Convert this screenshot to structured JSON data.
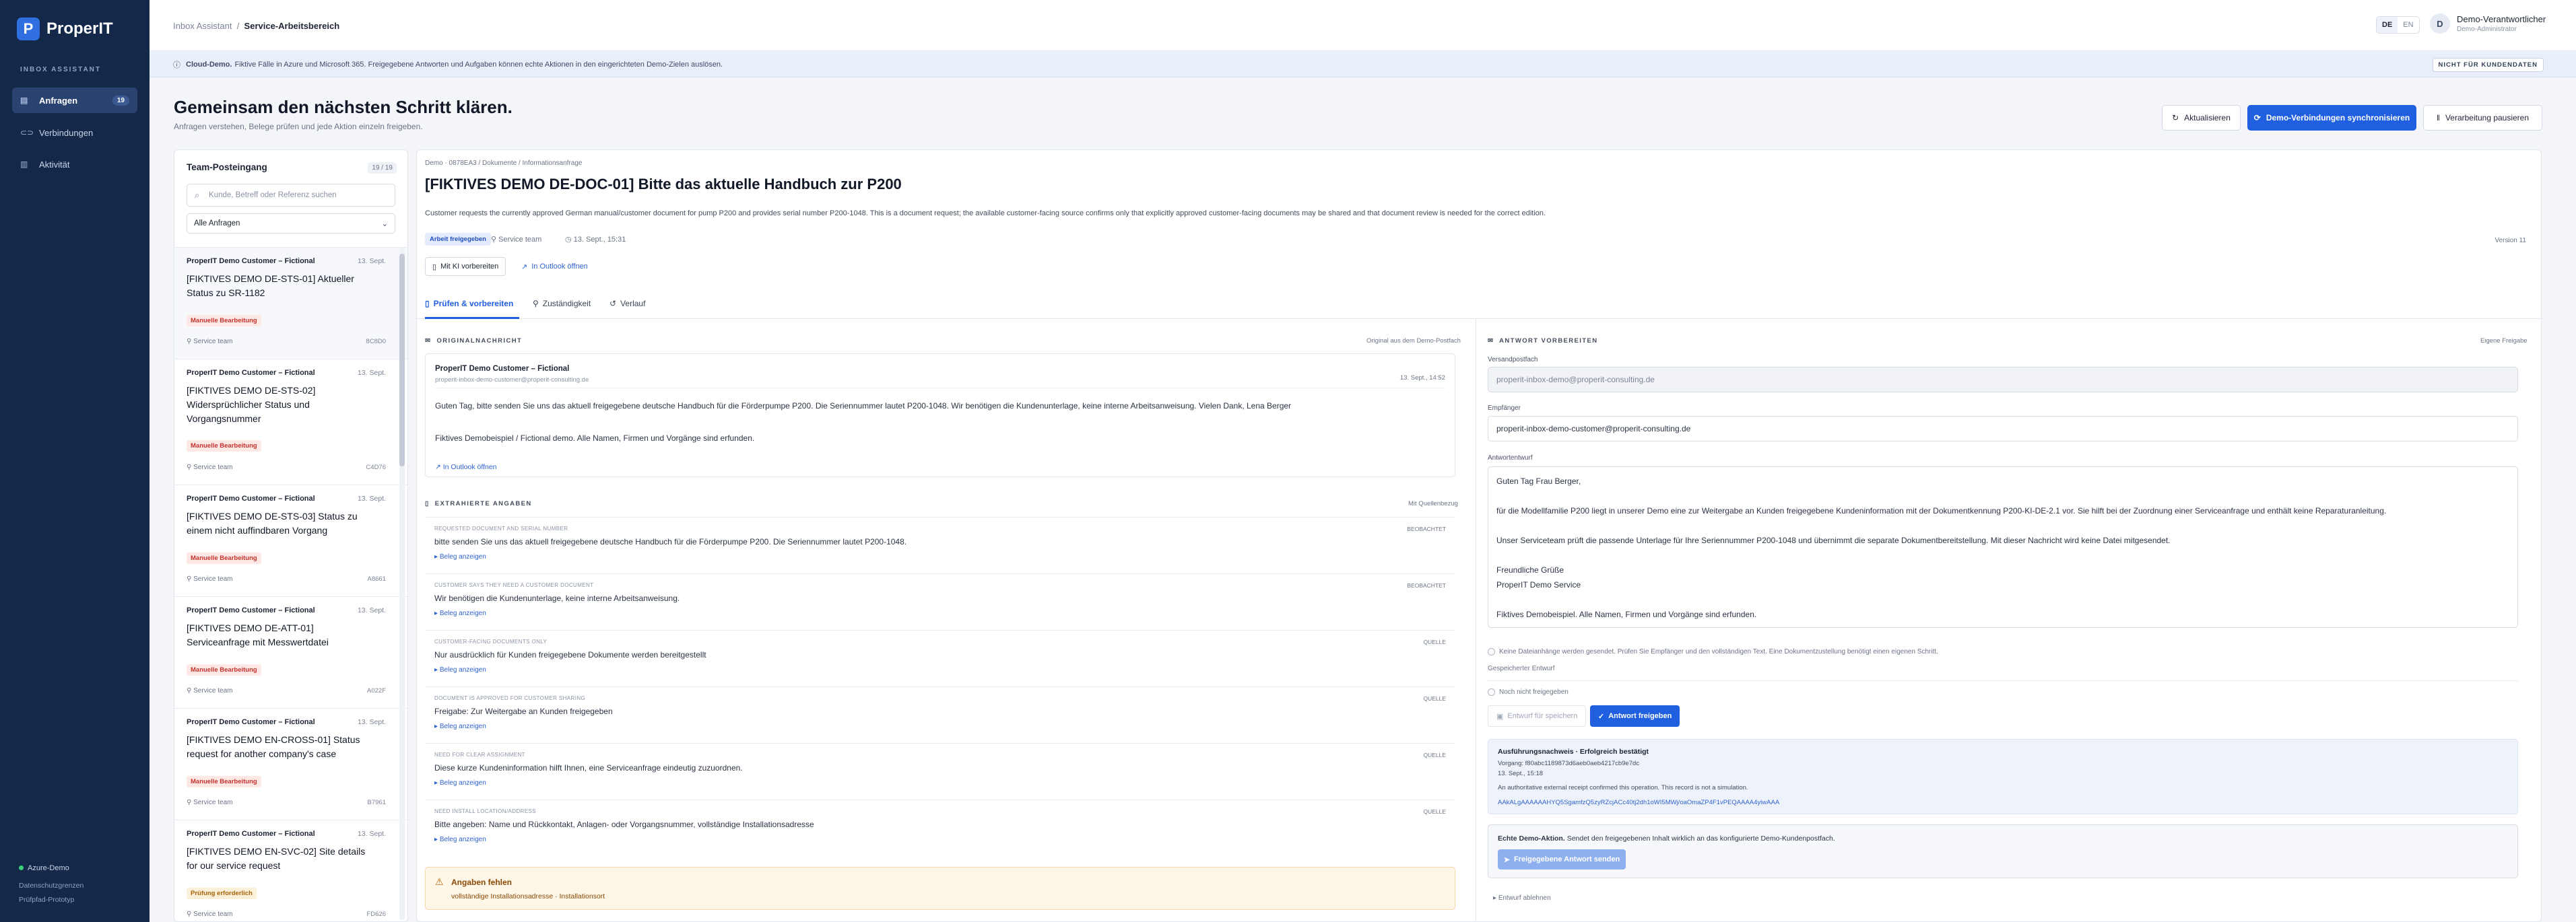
{
  "app": {
    "logo_letter": "P",
    "name": "ProperIT",
    "section": "INBOX ASSISTANT"
  },
  "sidebar": {
    "items": [
      {
        "label": "Anfragen",
        "badge": "19",
        "icon": "inbox-icon"
      },
      {
        "label": "Verbindungen",
        "icon": "link-icon"
      },
      {
        "label": "Aktivität",
        "icon": "activity-icon"
      }
    ],
    "env": "Azure-Demo",
    "footer1": "Datenschutzgrenzen",
    "footer2": "Prüfpfad-Prototyp"
  },
  "topbar": {
    "crumb1": "Inbox Assistant",
    "sep": "/",
    "crumb2": "Service-Arbeitsbereich",
    "lang": [
      "DE",
      "EN"
    ],
    "lang_active": "DE",
    "avatar": "D",
    "user": "Demo-Verantwortlicher",
    "role": "Demo-Administrator"
  },
  "banner": {
    "strong": "Cloud-Demo.",
    "text": "Fiktive Fälle in Azure und Microsoft 365. Freigegebene Antworten und Aufgaben können echte Aktionen in den eingerichteten Demo-Zielen auslösen.",
    "tag": "NICHT FÜR KUNDENDATEN"
  },
  "page": {
    "title": "Gemeinsam den nächsten Schritt klären.",
    "subtitle": "Anfragen verstehen, Belege prüfen und jede Aktion einzeln freigeben.",
    "btn_refresh": "Aktualisieren",
    "btn_sync": "Demo-Verbindungen synchronisieren",
    "btn_pause": "Verarbeitung pausieren"
  },
  "inbox": {
    "title": "Team-Posteingang",
    "count": "19 / 19",
    "search_placeholder": "Kunde, Betreff oder Referenz suchen",
    "filter": "Alle Anfragen",
    "items": [
      {
        "customer": "ProperIT Demo Customer – Fictional",
        "date": "13. Sept.",
        "title": "[FIKTIVES DEMO DE-STS-01] Aktueller Status zu SR-1182",
        "tag": "Manuelle Bearbeitung",
        "team": "Service team",
        "ref": "8C8D0"
      },
      {
        "customer": "ProperIT Demo Customer – Fictional",
        "date": "13. Sept.",
        "title": "[FIKTIVES DEMO DE-STS-02] Widersprüchlicher Status und Vorgangsnummer",
        "tag": "Manuelle Bearbeitung",
        "team": "Service team",
        "ref": "C4D76"
      },
      {
        "customer": "ProperIT Demo Customer – Fictional",
        "date": "13. Sept.",
        "title": "[FIKTIVES DEMO DE-STS-03] Status zu einem nicht auffindbaren Vorgang",
        "tag": "Manuelle Bearbeitung",
        "team": "Service team",
        "ref": "A8661"
      },
      {
        "customer": "ProperIT Demo Customer – Fictional",
        "date": "13. Sept.",
        "title": "[FIKTIVES DEMO DE-ATT-01] Serviceanfrage mit Messwertdatei",
        "tag": "Manuelle Bearbeitung",
        "team": "Service team",
        "ref": "A022F"
      },
      {
        "customer": "ProperIT Demo Customer – Fictional",
        "date": "13. Sept.",
        "title": "[FIKTIVES DEMO EN-CROSS-01] Status request for another company's case",
        "tag": "Manuelle Bearbeitung",
        "team": "Service team",
        "ref": "B7961"
      },
      {
        "customer": "ProperIT Demo Customer – Fictional",
        "date": "13. Sept.",
        "title": "[FIKTIVES DEMO EN-SVC-02] Site details for our service request",
        "tag": "Prüfung erforderlich",
        "team": "Service team",
        "ref": "FD626"
      }
    ]
  },
  "detail": {
    "crumb": "Demo · 0878EA3   /   Dokumente / Informationsanfrage",
    "title": "[FIKTIVES DEMO DE-DOC-01] Bitte das aktuelle Handbuch zur P200",
    "description": "Customer requests the currently approved German manual/customer document for pump P200 and provides serial number P200-1048. This is a document request; the available customer-facing source confirms only that explicitly approved customer-facing documents may be shared and that document review is needed for the correct edition.",
    "status_pill": "Arbeit freigegeben",
    "team": "Service team",
    "time": "13. Sept., 15:31",
    "version": "Version 11",
    "btn_ai": "Mit KI vorbereiten",
    "btn_outlook": "In Outlook öffnen",
    "tabs": [
      "Prüfen & vorbereiten",
      "Zuständigkeit",
      "Verlauf"
    ],
    "original": {
      "section": "ORIGINALNACHRICHT",
      "section_right": "Original aus dem Demo-Postfach",
      "from": "ProperIT Demo Customer – Fictional",
      "email": "properit-inbox-demo-customer@properit-consulting.de",
      "date": "13. Sept., 14:52",
      "body": "Guten Tag, bitte senden Sie uns das aktuell freigegebene deutsche Handbuch für die Förderpumpe P200. Die Seriennummer lautet P200-1048. Wir benötigen die Kundenunterlage, keine interne Arbeitsanweisung. Vielen Dank, Lena Berger",
      "disclaimer": "Fiktives Demobeispiel / Fictional demo. Alle Namen, Firmen und Vorgänge sind erfunden.",
      "link": "In Outlook öffnen"
    },
    "extracted": {
      "section": "EXTRAHIERTE ANGABEN",
      "section_right": "Mit Quellenbezug",
      "fields": [
        {
          "label": "REQUESTED DOCUMENT AND SERIAL NUMBER",
          "conf": "BEOBACHTET",
          "value": "bitte senden Sie uns das aktuell freigegebene deutsche Handbuch für die Förderpumpe P200. Die Seriennummer lautet P200-1048.",
          "src": "Beleg anzeigen"
        },
        {
          "label": "CUSTOMER SAYS THEY NEED A CUSTOMER DOCUMENT",
          "conf": "BEOBACHTET",
          "value": "Wir benötigen die Kundenunterlage, keine interne Arbeitsanweisung.",
          "src": "Beleg anzeigen"
        },
        {
          "label": "CUSTOMER-FACING DOCUMENTS ONLY",
          "conf": "QUELLE",
          "value": "Nur ausdrücklich für Kunden freigegebene Dokumente werden bereitgestellt",
          "src": "Beleg anzeigen"
        },
        {
          "label": "DOCUMENT IS APPROVED FOR CUSTOMER SHARING",
          "conf": "QUELLE",
          "value": "Freigabe: Zur Weitergabe an Kunden freigegeben",
          "src": "Beleg anzeigen"
        },
        {
          "label": "NEED FOR CLEAR ASSIGNMENT",
          "conf": "QUELLE",
          "value": "Diese kurze Kundeninformation hilft Ihnen, eine Serviceanfrage eindeutig zuzuordnen.",
          "src": "Beleg anzeigen"
        },
        {
          "label": "NEED INSTALL LOCATION/ADDRESS",
          "conf": "QUELLE",
          "value": "Bitte angeben: Name und Rückkontakt, Anlagen- oder Vorgangsnummer, vollständige Installationsadresse",
          "src": "Beleg anzeigen"
        }
      ],
      "warn_title": "Angaben fehlen",
      "warn_text": "vollständige Installationsadresse · Installationsort"
    },
    "reply": {
      "section": "ANTWORT VORBEREITEN",
      "section_right": "Eigene Freigabe",
      "sender_label": "Versandpostfach",
      "sender": "properit-inbox-demo@properit-consulting.de",
      "recipient_label": "Empfänger",
      "recipient": "properit-inbox-demo-customer@properit-consulting.de",
      "draft_label": "Antwortentwurf",
      "draft_lines": [
        "Guten Tag Frau Berger,",
        "",
        "für die Modellfamilie P200 liegt in unserer Demo eine zur Weitergabe an Kunden freigegebene Kundeninformation mit der Dokumentkennung P200-KI-DE-2.1 vor. Sie hilft bei der Zuordnung einer Serviceanfrage und enthält keine Reparaturanleitung.",
        "",
        "Unser Serviceteam prüft die passende Unterlage für Ihre Seriennummer P200-1048 und übernimmt die separate Dokumentbereitstellung. Mit dieser Nachricht wird keine Datei mitgesendet.",
        "",
        "Freundliche Grüße",
        "ProperIT Demo Service",
        "",
        "Fiktives Demobeispiel. Alle Namen, Firmen und Vorgänge sind erfunden."
      ],
      "note1": "Keine Dateianhänge werden gesendet. Prüfen Sie Empfänger und den vollständigen Text. Eine Dokumentzustellung benötigt einen eigenen Schritt.",
      "saved": "Gespeicherter Entwurf",
      "not_approved": "Noch nicht freigegeben",
      "btn_save": "Entwurf für speichern",
      "btn_approve": "Antwort freigeben",
      "receipt_title": "Ausführungsnachweis · Erfolgreich bestätigt",
      "receipt_id": "Vorgang: f80abc1189873d6aeb0aeb4217cb9e7dc",
      "receipt_time": "13. Sept., 15:18",
      "receipt_text": "An authoritative external receipt confirmed this operation. This record is not a simulation.",
      "receipt_hash": "AAkALgAAAAAAHYQ5SgamfzQ5zyRZcjACc40tj2dh1oWI5MWj/oaOmaZP4F1vPEQAAAA4yiwAAA",
      "send_title": "Echte Demo-Aktion.",
      "send_text": "Sendet den freigegebenen Inhalt wirklich an das konfigurierte Demo-Kundenpostfach.",
      "send_btn": "Freigegebene Antwort senden",
      "discard": "Entwurf ablehnen"
    }
  },
  "colors": {
    "sidebar": "#14284a",
    "accent": "#1f5fe0",
    "danger_tag": "#c4322b",
    "warn_bg": "#fef6e7"
  }
}
